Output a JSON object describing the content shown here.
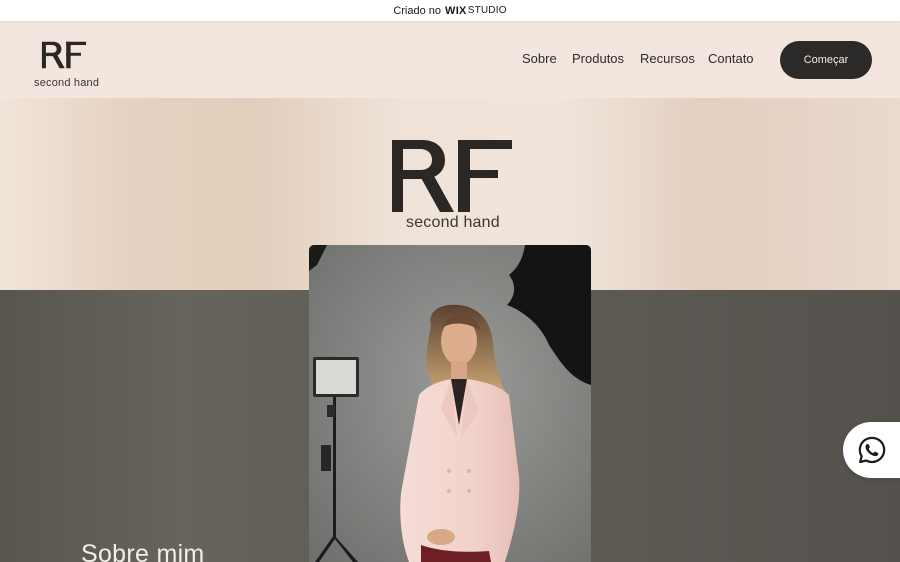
{
  "wix_banner": {
    "prefix": "Criado no",
    "brand_bold": "WIX",
    "brand_light": "STUDIO"
  },
  "header": {
    "logo_monogram": "RF",
    "logo_tagline": "second hand",
    "nav": [
      "Sobre",
      "Produtos",
      "Recursos",
      "Contato"
    ],
    "cta_label": "Começar"
  },
  "hero": {
    "logo_monogram": "RF",
    "logo_tagline": "second hand"
  },
  "about": {
    "title": "Sobre mim"
  },
  "floating": {
    "icon": "whatsapp-icon"
  },
  "colors": {
    "dark": "#2b2a28",
    "header_bg": "#f2e6de",
    "section_dark": "#5c5953",
    "suit": "#f4d9d3"
  }
}
